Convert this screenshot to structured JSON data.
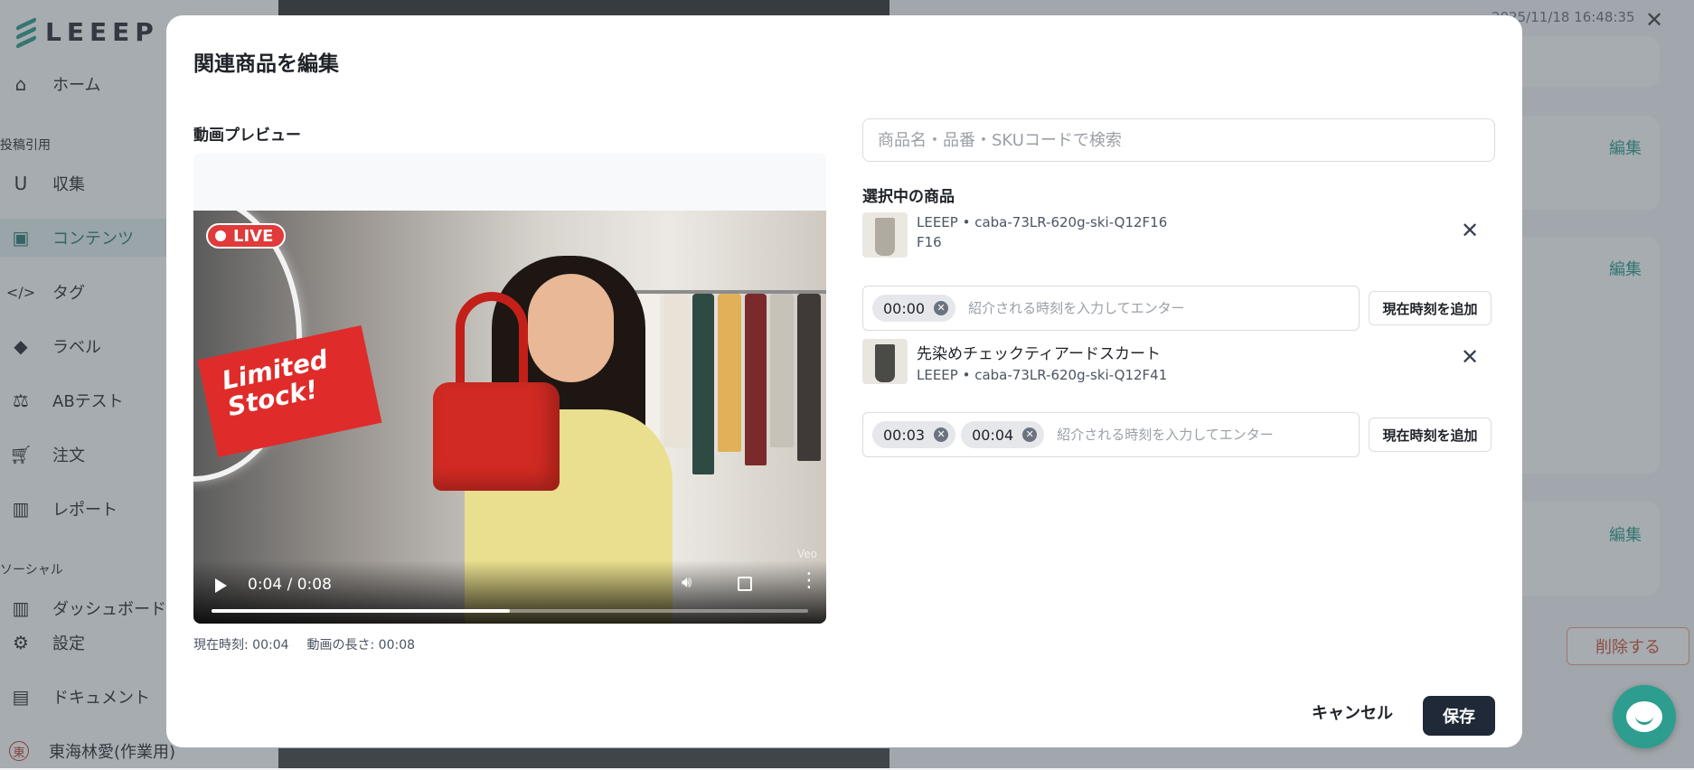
{
  "background": {
    "logo": "LEEEP",
    "timestamp": "2025/11/18 16:48:35",
    "nav": {
      "home": "ホーム",
      "section_posts": "投稿引用",
      "collect": "収集",
      "contents": "コンテンツ",
      "tags": "タグ",
      "labels": "ラベル",
      "abtest": "ABテスト",
      "orders": "注文",
      "reports": "レポート",
      "section_social": "ソーシャル",
      "dashboard": "ダッシュボード",
      "settings": "設定",
      "documents": "ドキュメント",
      "user": "東海林愛(作業用)",
      "user_initial": "東"
    },
    "edit_label": "編集",
    "delete_label": "削除する"
  },
  "modal": {
    "title": "関連商品を編集",
    "video_section_label": "動画プレビュー",
    "live_badge": "LIVE",
    "promo_line1": "Limited",
    "promo_line2": "Stock!",
    "watermark": "Veo",
    "player_time": "0:04 / 0:08",
    "progress": 0.5,
    "current_time_label": "現在時刻: 00:04",
    "duration_label": "動画の長さ: 00:08",
    "search_placeholder": "商品名・品番・SKUコードで検索",
    "selected_label": "選択中の商品",
    "products": [
      {
        "line1": "LEEEP • caba-73LR-620g-ski-Q12F16",
        "line2": "F16",
        "times": [
          "00:00"
        ],
        "time_placeholder": "紹介される時刻を入力してエンター",
        "add_now": "現在時刻を追加"
      },
      {
        "line1": "先染めチェックティアードスカート",
        "line2": "LEEEP • caba-73LR-620g-ski-Q12F41",
        "times": [
          "00:03",
          "00:04"
        ],
        "time_placeholder": "紹介される時刻を入力してエンター",
        "add_now": "現在時刻を追加"
      }
    ],
    "cancel": "キャンセル",
    "save": "保存"
  },
  "colors": {
    "accent": "#2d9d8f",
    "save_bg": "#1f2937",
    "live_red": "#e03a3a"
  }
}
